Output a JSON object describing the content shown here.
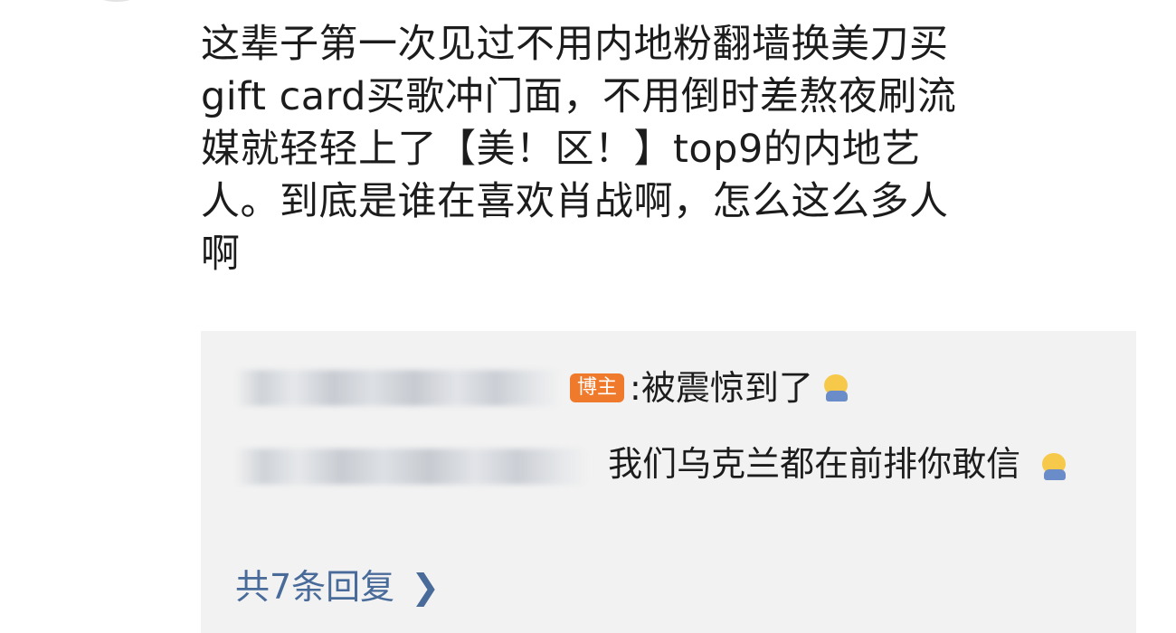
{
  "comment": {
    "lines": [
      "这辈子第一次见过不用内地粉翻墙换美刀买",
      "gift card买歌冲门面，不用倒时差熬夜刷流",
      "媒就轻轻上了【美！区！】top9的内地艺",
      "人。到底是谁在喜欢肖战啊，怎么这么多人",
      "啊"
    ]
  },
  "replies": [
    {
      "badge": "博主",
      "text": ":被震惊到了",
      "emoji_icon": "shock-face-emoji"
    },
    {
      "text": "我们乌克兰都在前排你敢信",
      "emoji_icon": "smirk-face-emoji"
    }
  ],
  "more_replies_label": "共7条回复",
  "colors": {
    "badge": "#f07a2b",
    "link": "#486b9a",
    "reply_bg": "#f2f2f2"
  }
}
